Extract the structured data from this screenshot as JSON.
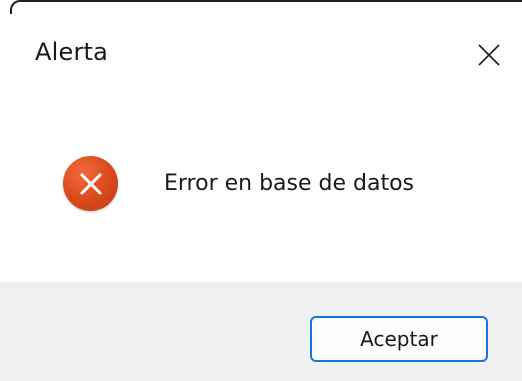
{
  "window": {
    "title": "Alerta",
    "close_icon": "close-icon"
  },
  "content": {
    "icon": "error-icon",
    "icon_color": "#d9481d",
    "message": "Error en base de datos"
  },
  "footer": {
    "ok_label": "Aceptar",
    "ok_border_color": "#1a73d9"
  }
}
